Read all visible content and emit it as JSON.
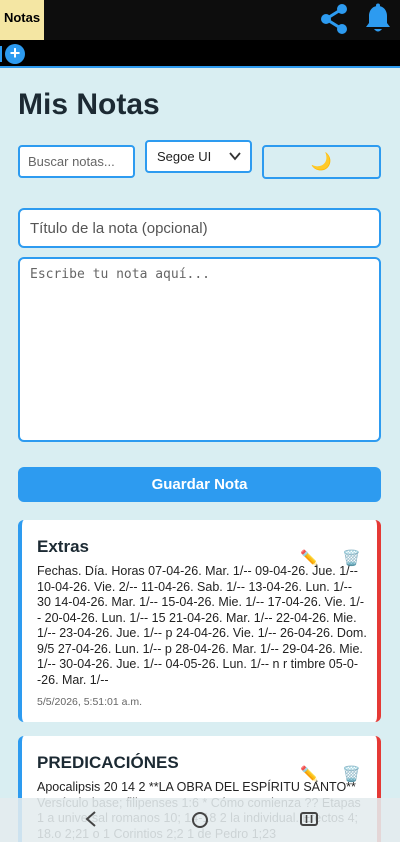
{
  "topbar": {
    "app_tab_label": "Notas",
    "share_icon": "share-icon",
    "bell_icon": "bell-icon"
  },
  "tabstrip": {
    "add_icon": "+"
  },
  "header": {
    "title": "Mis Notas"
  },
  "toolbar": {
    "search_placeholder": "Buscar notas...",
    "font_value": "Segoe UI",
    "theme_icon": "🌙"
  },
  "editor": {
    "title_placeholder": "Título de la nota (opcional)",
    "body_placeholder": "Escribe tu nota aquí...",
    "save_label": "Guardar Nota"
  },
  "notes": [
    {
      "title": "Extras",
      "body": "Fechas. Día. Horas 07-04-26. Mar. 1/-- 09-04-26. Jue. 1/-- 10-04-26. Vie. 2/-- 11-04-26. Sab. 1/-- 13-04-26. Lun. 1/-- 30 14-04-26. Mar. 1/-- 15-04-26. Mie. 1/-- 17-04-26. Vie. 1/-- 20-04-26. Lun. 1/-- 15 21-04-26. Mar. 1/-- 22-04-26. Mie. 1/-- 23-04-26. Jue. 1/-- p 24-04-26. Vie. 1/-- 26-04-26. Dom. 9/5 27-04-26. Lun. 1/-- p 28-04-26. Mar. 1/-- 29-04-26. Mie. 1/-- 30-04-26. Jue. 1/-- 04-05-26. Lun. 1/-- n r timbre 05-0--26. Mar. 1/--",
      "date": "5/5/2026, 5:51:01 a.m.",
      "edit_icon": "✏️",
      "delete_icon": "🗑️"
    },
    {
      "title": "PREDICACIÓNES",
      "body": "Apocalipsis 20 14 2 **LA OBRA DEL ESPÍRITU SANTO** Versículo base; filipenses 1:6 * Cómo comienza ?? Etapas 1 a universal romanos 10; 14-18 2 la individual. Efectos 4; 18.o 2;21 o 1 Corintios 2;2 1 de Pedro 1;23",
      "edit_icon": "✏️",
      "delete_icon": "🗑️"
    }
  ],
  "navbar": {
    "back_icon": "back-icon",
    "home_icon": "home-icon",
    "recent_icon": "recent-apps-icon"
  },
  "colors": {
    "accent": "#2d9bf0",
    "danger": "#e53935",
    "background": "#d9eef2",
    "tab": "#f4e6a3"
  }
}
